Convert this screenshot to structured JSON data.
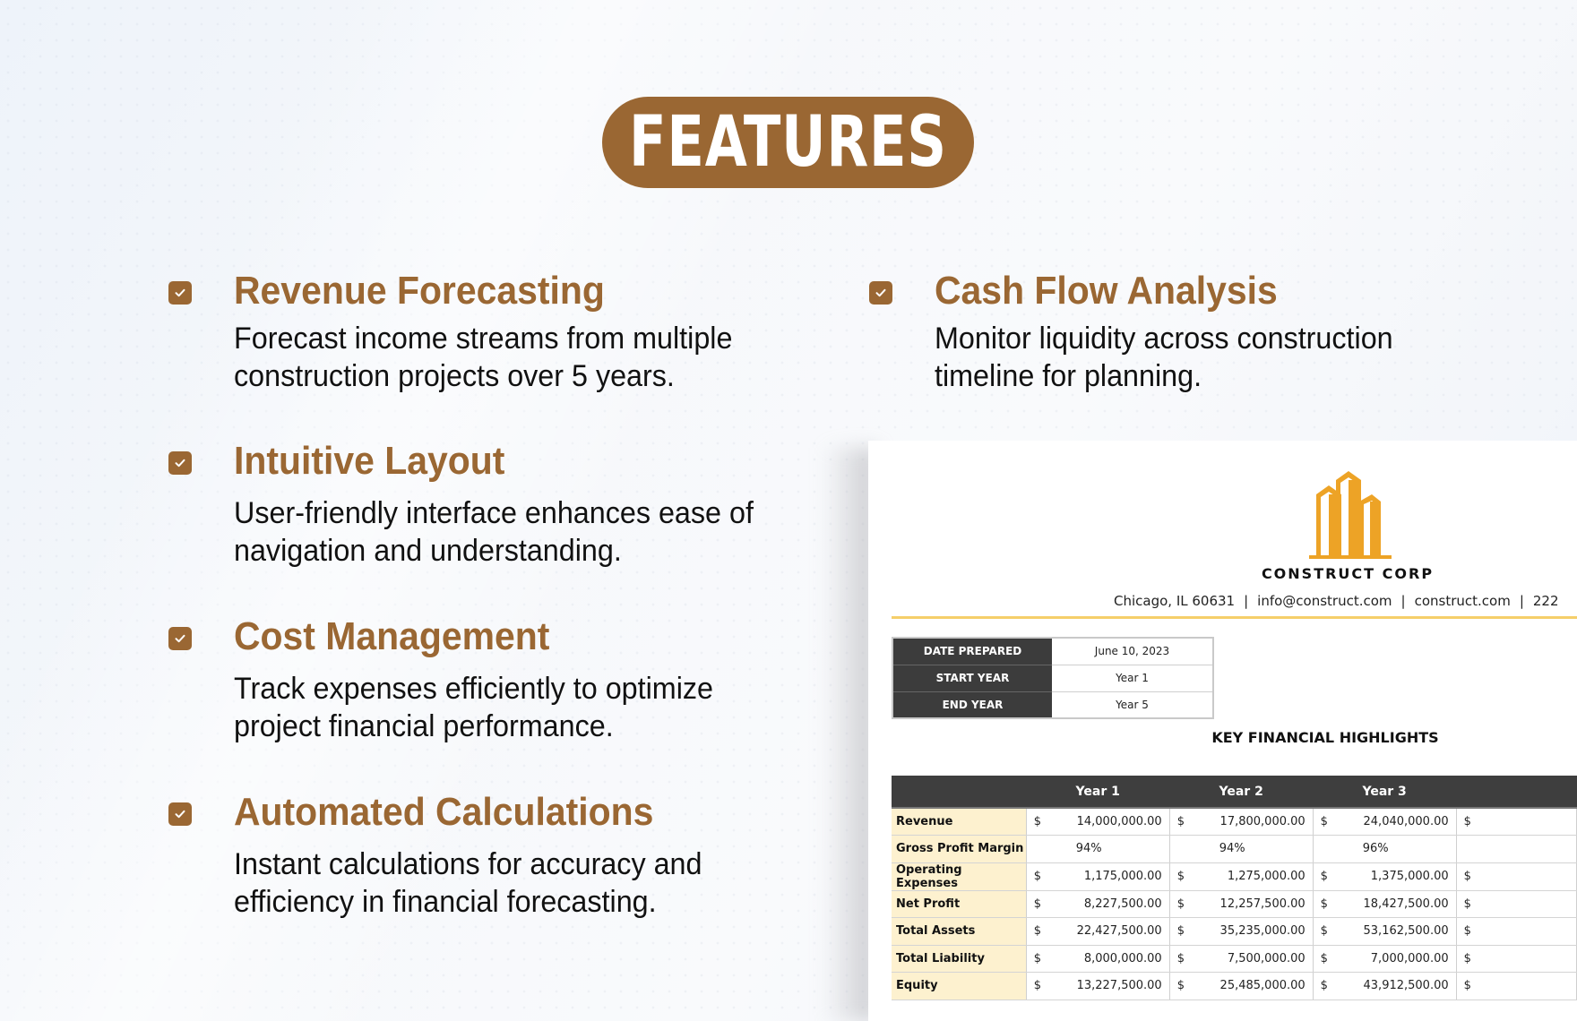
{
  "header": {
    "title": "FEATURES"
  },
  "colors": {
    "brand": "#9a6733",
    "logo": "#eda326",
    "rule": "#f5cf6a",
    "header_dark": "#3e3e3e",
    "label_bg": "#fdf1cf"
  },
  "features": [
    {
      "icon": "checkbox-checked-icon",
      "title": "Revenue Forecasting",
      "description": "Forecast income streams from multiple construction projects over 5 years."
    },
    {
      "icon": "checkbox-checked-icon",
      "title": "Cash Flow Analysis",
      "description": "Monitor liquidity across construction timeline for planning."
    },
    {
      "icon": "checkbox-checked-icon",
      "title": "Intuitive Layout",
      "description": "User-friendly interface enhances ease of navigation and understanding."
    },
    {
      "icon": "checkbox-checked-icon",
      "title": "Cost Management",
      "description": "Track expenses efficiently to optimize project financial performance."
    },
    {
      "icon": "checkbox-checked-icon",
      "title": "Automated Calculations",
      "description": "Instant calculations for accuracy and efficiency in financial forecasting."
    }
  ],
  "document": {
    "logo_icon": "buildings-logo-icon",
    "company": "CONSTRUCT CORP",
    "contact": {
      "address": "Chicago, IL 60631",
      "email": "info@construct.com",
      "website": "construct.com",
      "phone": "222",
      "separator": "|"
    },
    "info": [
      {
        "label": "DATE PREPARED",
        "value": "June 10, 2023"
      },
      {
        "label": "START YEAR",
        "value": "Year 1"
      },
      {
        "label": "END YEAR",
        "value": "Year 5"
      }
    ],
    "highlights_title": "KEY FINANCIAL HIGHLIGHTS",
    "table": {
      "columns": [
        "",
        "Year 1",
        "Year 2",
        "Year 3",
        ""
      ],
      "currency": "$",
      "rows": [
        {
          "label": "Revenue",
          "type": "money",
          "values": [
            "14,000,000.00",
            "17,800,000.00",
            "24,040,000.00",
            ""
          ]
        },
        {
          "label": "Gross Profit Margin",
          "type": "pct",
          "values": [
            "94%",
            "94%",
            "96%",
            ""
          ]
        },
        {
          "label": "Operating Expenses",
          "type": "money",
          "values": [
            "1,175,000.00",
            "1,275,000.00",
            "1,375,000.00",
            ""
          ]
        },
        {
          "label": "Net Profit",
          "type": "money",
          "values": [
            "8,227,500.00",
            "12,257,500.00",
            "18,427,500.00",
            ""
          ]
        },
        {
          "label": "Total Assets",
          "type": "money",
          "values": [
            "22,427,500.00",
            "35,235,000.00",
            "53,162,500.00",
            ""
          ]
        },
        {
          "label": "Total Liability",
          "type": "money",
          "values": [
            "8,000,000.00",
            "7,500,000.00",
            "7,000,000.00",
            ""
          ]
        },
        {
          "label": "Equity",
          "type": "money",
          "values": [
            "13,227,500.00",
            "25,485,000.00",
            "43,912,500.00",
            ""
          ]
        }
      ]
    }
  }
}
